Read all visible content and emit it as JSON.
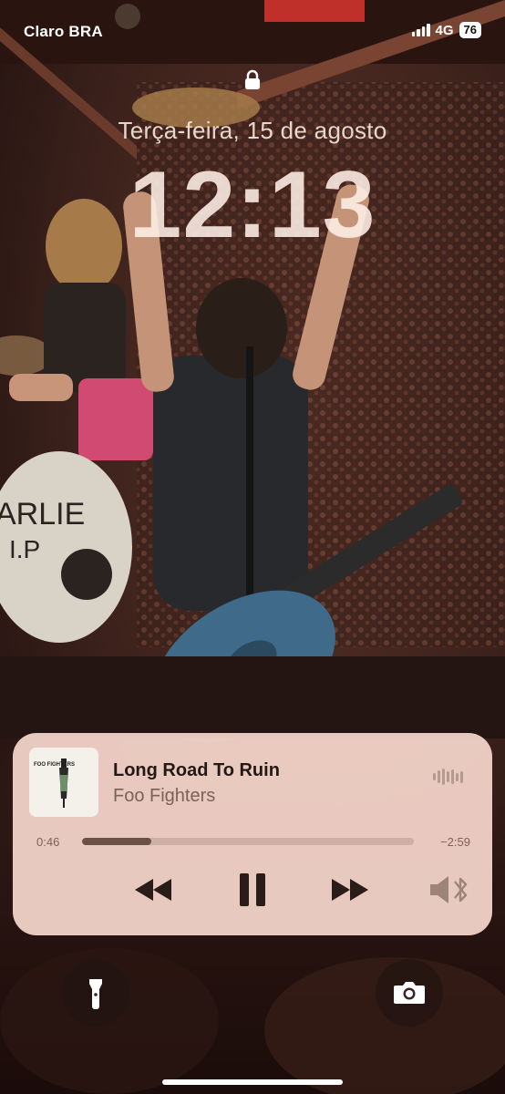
{
  "status_bar": {
    "carrier": "Claro BRA",
    "network": "4G",
    "battery": "76"
  },
  "lock_screen": {
    "date": "Terça-feira, 15 de agosto",
    "time": "12:13"
  },
  "now_playing": {
    "title": "Long Road To Ruin",
    "artist": "Foo Fighters",
    "elapsed": "0:46",
    "remaining": "−2:59",
    "progress": 0.21,
    "artwork_label": "FOO FIGHTERS"
  },
  "icons": {
    "lock": "lock-icon",
    "rewind": "rewind-icon",
    "pause": "pause-icon",
    "forward": "forward-icon",
    "audio_output": "speaker-bluetooth-icon",
    "flashlight": "flashlight-icon",
    "camera": "camera-icon",
    "waveform": "waveform-icon"
  },
  "colors": {
    "player_bg": "#f4d4ca",
    "accent": "#6b5048"
  }
}
